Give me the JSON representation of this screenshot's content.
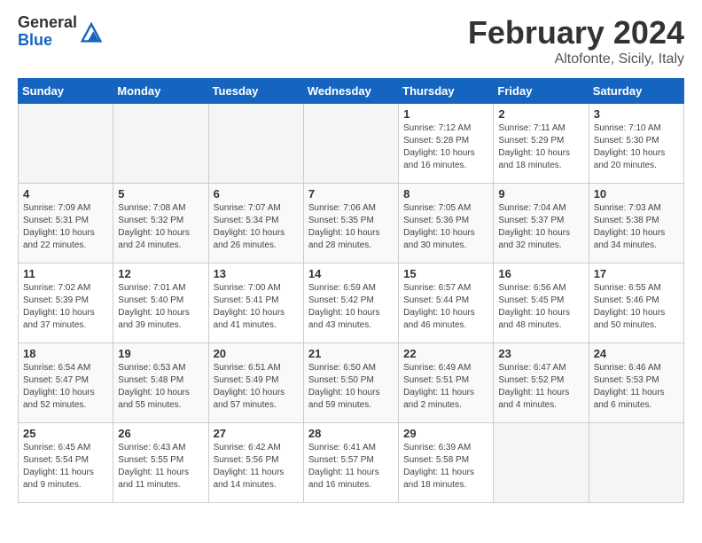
{
  "header": {
    "logo_line1": "General",
    "logo_line2": "Blue",
    "month_title": "February 2024",
    "location": "Altofonte, Sicily, Italy"
  },
  "days_of_week": [
    "Sunday",
    "Monday",
    "Tuesday",
    "Wednesday",
    "Thursday",
    "Friday",
    "Saturday"
  ],
  "weeks": [
    [
      {
        "num": "",
        "info": ""
      },
      {
        "num": "",
        "info": ""
      },
      {
        "num": "",
        "info": ""
      },
      {
        "num": "",
        "info": ""
      },
      {
        "num": "1",
        "info": "Sunrise: 7:12 AM\nSunset: 5:28 PM\nDaylight: 10 hours\nand 16 minutes."
      },
      {
        "num": "2",
        "info": "Sunrise: 7:11 AM\nSunset: 5:29 PM\nDaylight: 10 hours\nand 18 minutes."
      },
      {
        "num": "3",
        "info": "Sunrise: 7:10 AM\nSunset: 5:30 PM\nDaylight: 10 hours\nand 20 minutes."
      }
    ],
    [
      {
        "num": "4",
        "info": "Sunrise: 7:09 AM\nSunset: 5:31 PM\nDaylight: 10 hours\nand 22 minutes."
      },
      {
        "num": "5",
        "info": "Sunrise: 7:08 AM\nSunset: 5:32 PM\nDaylight: 10 hours\nand 24 minutes."
      },
      {
        "num": "6",
        "info": "Sunrise: 7:07 AM\nSunset: 5:34 PM\nDaylight: 10 hours\nand 26 minutes."
      },
      {
        "num": "7",
        "info": "Sunrise: 7:06 AM\nSunset: 5:35 PM\nDaylight: 10 hours\nand 28 minutes."
      },
      {
        "num": "8",
        "info": "Sunrise: 7:05 AM\nSunset: 5:36 PM\nDaylight: 10 hours\nand 30 minutes."
      },
      {
        "num": "9",
        "info": "Sunrise: 7:04 AM\nSunset: 5:37 PM\nDaylight: 10 hours\nand 32 minutes."
      },
      {
        "num": "10",
        "info": "Sunrise: 7:03 AM\nSunset: 5:38 PM\nDaylight: 10 hours\nand 34 minutes."
      }
    ],
    [
      {
        "num": "11",
        "info": "Sunrise: 7:02 AM\nSunset: 5:39 PM\nDaylight: 10 hours\nand 37 minutes."
      },
      {
        "num": "12",
        "info": "Sunrise: 7:01 AM\nSunset: 5:40 PM\nDaylight: 10 hours\nand 39 minutes."
      },
      {
        "num": "13",
        "info": "Sunrise: 7:00 AM\nSunset: 5:41 PM\nDaylight: 10 hours\nand 41 minutes."
      },
      {
        "num": "14",
        "info": "Sunrise: 6:59 AM\nSunset: 5:42 PM\nDaylight: 10 hours\nand 43 minutes."
      },
      {
        "num": "15",
        "info": "Sunrise: 6:57 AM\nSunset: 5:44 PM\nDaylight: 10 hours\nand 46 minutes."
      },
      {
        "num": "16",
        "info": "Sunrise: 6:56 AM\nSunset: 5:45 PM\nDaylight: 10 hours\nand 48 minutes."
      },
      {
        "num": "17",
        "info": "Sunrise: 6:55 AM\nSunset: 5:46 PM\nDaylight: 10 hours\nand 50 minutes."
      }
    ],
    [
      {
        "num": "18",
        "info": "Sunrise: 6:54 AM\nSunset: 5:47 PM\nDaylight: 10 hours\nand 52 minutes."
      },
      {
        "num": "19",
        "info": "Sunrise: 6:53 AM\nSunset: 5:48 PM\nDaylight: 10 hours\nand 55 minutes."
      },
      {
        "num": "20",
        "info": "Sunrise: 6:51 AM\nSunset: 5:49 PM\nDaylight: 10 hours\nand 57 minutes."
      },
      {
        "num": "21",
        "info": "Sunrise: 6:50 AM\nSunset: 5:50 PM\nDaylight: 10 hours\nand 59 minutes."
      },
      {
        "num": "22",
        "info": "Sunrise: 6:49 AM\nSunset: 5:51 PM\nDaylight: 11 hours\nand 2 minutes."
      },
      {
        "num": "23",
        "info": "Sunrise: 6:47 AM\nSunset: 5:52 PM\nDaylight: 11 hours\nand 4 minutes."
      },
      {
        "num": "24",
        "info": "Sunrise: 6:46 AM\nSunset: 5:53 PM\nDaylight: 11 hours\nand 6 minutes."
      }
    ],
    [
      {
        "num": "25",
        "info": "Sunrise: 6:45 AM\nSunset: 5:54 PM\nDaylight: 11 hours\nand 9 minutes."
      },
      {
        "num": "26",
        "info": "Sunrise: 6:43 AM\nSunset: 5:55 PM\nDaylight: 11 hours\nand 11 minutes."
      },
      {
        "num": "27",
        "info": "Sunrise: 6:42 AM\nSunset: 5:56 PM\nDaylight: 11 hours\nand 14 minutes."
      },
      {
        "num": "28",
        "info": "Sunrise: 6:41 AM\nSunset: 5:57 PM\nDaylight: 11 hours\nand 16 minutes."
      },
      {
        "num": "29",
        "info": "Sunrise: 6:39 AM\nSunset: 5:58 PM\nDaylight: 11 hours\nand 18 minutes."
      },
      {
        "num": "",
        "info": ""
      },
      {
        "num": "",
        "info": ""
      }
    ]
  ]
}
